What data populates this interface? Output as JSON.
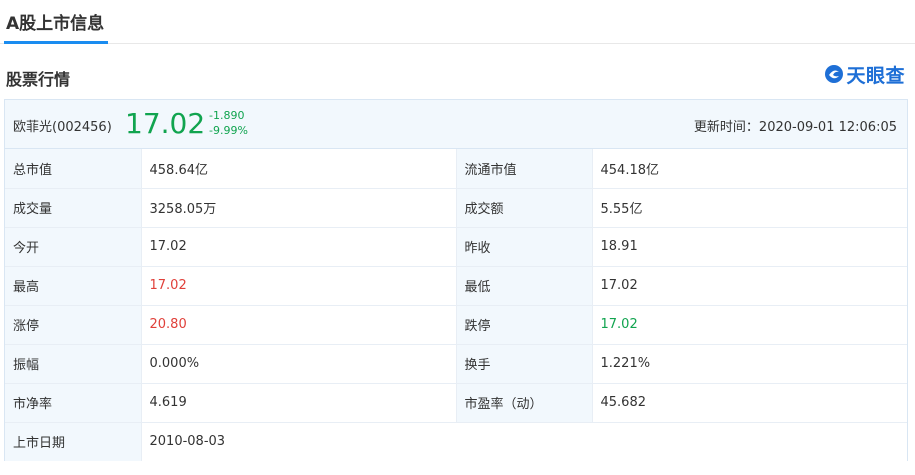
{
  "tab": {
    "title": "A股上市信息"
  },
  "section": {
    "title": "股票行情"
  },
  "logo": {
    "text": "天眼查",
    "color": "#1e6fd6"
  },
  "quote": {
    "name": "欧菲光(002456)",
    "price": "17.02",
    "change_abs": "-1.890",
    "change_pct": "-9.99%",
    "update_label": "更新时间：",
    "update_time": "2020-09-01 12:06:05"
  },
  "colors": {
    "up": "#e0403a",
    "down": "#11a44f",
    "accent": "#1a8cf0",
    "header_bg": "#f2f8fd"
  },
  "rows": [
    {
      "l1": "总市值",
      "v1": "458.64亿",
      "l2": "流通市值",
      "v2": "454.18亿"
    },
    {
      "l1": "成交量",
      "v1": "3258.05万",
      "l2": "成交额",
      "v2": "5.55亿"
    },
    {
      "l1": "今开",
      "v1": "17.02",
      "l2": "昨收",
      "v2": "18.91"
    },
    {
      "l1": "最高",
      "v1": "17.02",
      "l2": "最低",
      "v2": "17.02"
    },
    {
      "l1": "涨停",
      "v1": "20.80",
      "l2": "跌停",
      "v2": "17.02"
    },
    {
      "l1": "振幅",
      "v1": "0.000%",
      "l2": "换手",
      "v2": "1.221%"
    },
    {
      "l1": "市净率",
      "v1": "4.619",
      "l2": "市盈率（动）",
      "v2": "45.682"
    },
    {
      "l1": "上市日期",
      "v1": "2010-08-03"
    }
  ]
}
